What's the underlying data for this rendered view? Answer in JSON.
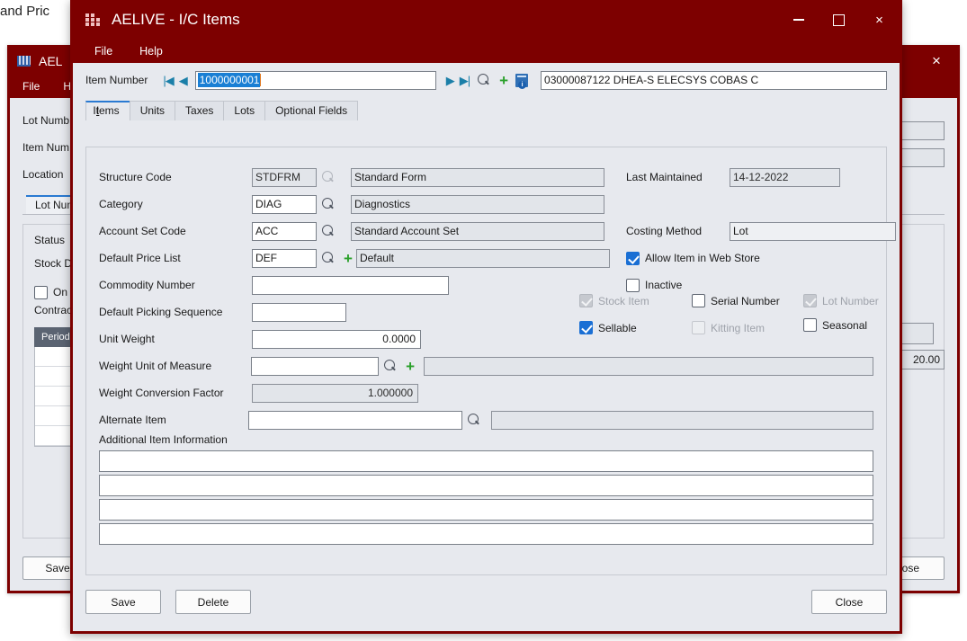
{
  "desktop": {
    "behind_text": "and Pric"
  },
  "background_window": {
    "title": "AEL",
    "icon": "barcode-icon",
    "close_label": "×",
    "menu": [
      "File",
      "H"
    ],
    "fields": [
      {
        "label": "Lot Numb"
      },
      {
        "label": "Item Num"
      },
      {
        "label": "Location"
      }
    ],
    "tab_label": "Lot Num",
    "panel_labels": [
      "Status",
      "Stock D"
    ],
    "checkbox_label": "On",
    "contract_label": "Contrac",
    "grid": {
      "header": "Period",
      "rows": [
        "",
        "",
        "",
        "",
        ""
      ]
    },
    "value_field": "20.00",
    "buttons": {
      "save": "Save",
      "close": "lose"
    }
  },
  "dialog": {
    "title": "AELIVE - I/C Items",
    "icon": "grid-squares-icon",
    "window_controls": {
      "minimize": "minimize-icon",
      "maximize": "maximize-icon",
      "close": "×"
    },
    "menu": [
      "File",
      "Help"
    ],
    "item_bar": {
      "label": "Item Number",
      "value": "1000000001",
      "description": "03000087122 DHEA-S ELECSYS COBAS C",
      "nav_first": "|◀",
      "nav_prev": "◀",
      "nav_next": "▶",
      "nav_last": "▶|",
      "finder_icon": "search-icon",
      "new_icon": "plus-icon",
      "doc_icon": "document-info-icon"
    },
    "tabs": [
      {
        "label": "Items",
        "mnemonic": 1,
        "active": true
      },
      {
        "label": "Units",
        "mnemonic": 0,
        "active": false
      },
      {
        "label": "Taxes",
        "mnemonic": 2,
        "active": false
      },
      {
        "label": "Lots",
        "mnemonic": 1,
        "active": false
      },
      {
        "label": "Optional Fields",
        "mnemonic": 6,
        "active": false
      }
    ],
    "form": {
      "left_fields": [
        {
          "label": "Structure Code",
          "code": "STDFRM",
          "code_disabled": true,
          "has_finder": true,
          "finder_disabled": true,
          "has_plus": false,
          "description": "Standard Form",
          "desc_disabled": true,
          "desc_width": 280
        },
        {
          "label": "Category",
          "code": "DIAG",
          "code_disabled": false,
          "has_finder": true,
          "finder_disabled": false,
          "has_plus": false,
          "description": "Diagnostics",
          "desc_disabled": true,
          "desc_width": 280
        },
        {
          "label": "Account Set Code",
          "code": "ACC",
          "code_disabled": false,
          "has_finder": true,
          "finder_disabled": false,
          "has_plus": false,
          "description": "Standard Account Set",
          "desc_disabled": true,
          "desc_width": 280
        },
        {
          "label": "Default Price List",
          "code": "DEF",
          "code_disabled": false,
          "has_finder": true,
          "finder_disabled": false,
          "has_plus": true,
          "description": "Default",
          "desc_disabled": true,
          "desc_width": 280
        }
      ],
      "commodity_number": {
        "label": "Commodity Number",
        "value": ""
      },
      "default_picking_sequence": {
        "label": "Default Picking Sequence",
        "value": ""
      },
      "unit_weight": {
        "label": "Unit Weight",
        "value": "0.0000"
      },
      "weight_uom": {
        "label": "Weight Unit of Measure",
        "value": "",
        "description": ""
      },
      "weight_conversion_factor": {
        "label": "Weight Conversion Factor",
        "value": "1.000000"
      },
      "alternate_item": {
        "label": "Alternate Item",
        "value": "",
        "description": ""
      },
      "last_maintained": {
        "label": "Last Maintained",
        "value": "14-12-2022"
      },
      "costing_method": {
        "label": "Costing Method",
        "value": "Lot"
      },
      "checkboxes": [
        {
          "label": "Allow Item in Web Store",
          "checked": true,
          "disabled": false
        },
        {
          "label": "Inactive",
          "checked": false,
          "disabled": false
        },
        {
          "label": "Stock Item",
          "checked": true,
          "disabled": true
        },
        {
          "label": "Serial Number",
          "checked": false,
          "disabled": false
        },
        {
          "label": "Lot Number",
          "checked": true,
          "disabled": true
        },
        {
          "label": "Sellable",
          "checked": true,
          "disabled": false
        },
        {
          "label": "Kitting Item",
          "checked": false,
          "disabled": true
        },
        {
          "label": "Seasonal",
          "checked": false,
          "disabled": false
        }
      ],
      "additional_item_information": {
        "label": "Additional Item Information",
        "lines": [
          "",
          "",
          "",
          ""
        ]
      }
    },
    "footer": {
      "save": "Save",
      "delete": "Delete",
      "close": "Close"
    }
  },
  "colors": {
    "title_bar": "#7d0000",
    "window_bg": "#e7e9ee",
    "accent_blue": "#1a6fd4",
    "nav_arrow": "#1b7fa8",
    "plus_green": "#2aa02a"
  }
}
